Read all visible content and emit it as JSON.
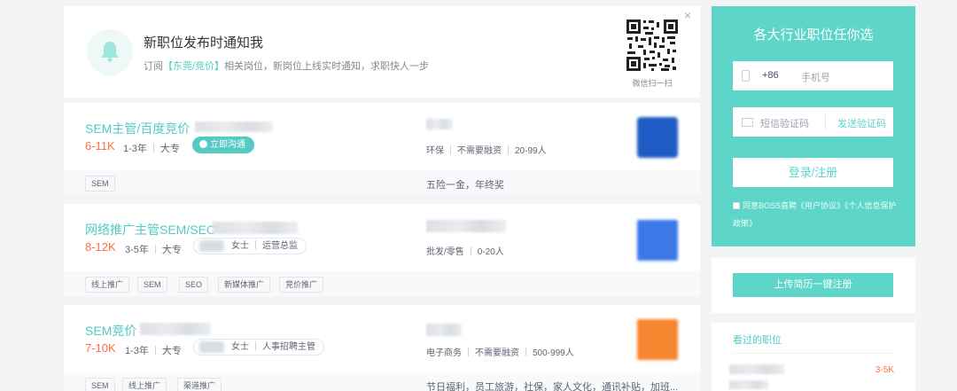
{
  "notify": {
    "title": "新职位发布时通知我",
    "sub_prefix": "订阅",
    "sub_highlight": "【东莞/竞价】",
    "sub_suffix": "相关岗位，新岗位上线实时通知，求职快人一步",
    "qr_label": "微信扫一扫",
    "close": "×"
  },
  "jobs": [
    {
      "title": "SEM主管/百度竞价",
      "salary": "6-11K",
      "experience": "1-3年",
      "education": "大专",
      "chat_label": "立即沟通",
      "company_industry": "环保",
      "company_funding": "不需要融资",
      "company_size": "20-99人",
      "tags": [
        "SEM"
      ],
      "welfare": "五险一金，年终奖",
      "logo_color": "#1f5bc4"
    },
    {
      "title": "网络推广主管SEM/SEO",
      "salary": "8-12K",
      "experience": "3-5年",
      "education": "大专",
      "hr_suffix": "女士",
      "hr_role": "运营总监",
      "company_industry": "批发/零售",
      "company_size": "0-20人",
      "tags": [
        "线上推广",
        "SEM",
        "SEO",
        "新媒体推广",
        "竞价推广"
      ],
      "welfare": "",
      "logo_color": "#3b79e8"
    },
    {
      "title": "SEM竞价",
      "salary": "7-10K",
      "experience": "1-3年",
      "education": "大专",
      "hr_suffix": "女士",
      "hr_role": "人事招聘主管",
      "company_industry": "电子商务",
      "company_funding": "不需要融资",
      "company_size": "500-999人",
      "tags": [
        "SEM",
        "线上推广",
        "渠道推广"
      ],
      "welfare": "节日福利，员工旅游，社保，家人文化，通讯补贴，加班...",
      "logo_color": "#f5852e"
    }
  ],
  "register": {
    "title": "各大行业职位任你选",
    "country_code": "+86",
    "phone_placeholder": "手机号",
    "sms_placeholder": "短信验证码",
    "send_code": "发送验证码",
    "login_button": "登录/注册",
    "agree_text": "同意BOSS直聘《用户协议》《个人信息保护政策》"
  },
  "upload_button": "上传简历一键注册",
  "viewed": {
    "title": "看过的职位",
    "salary": "3-5K"
  },
  "colors": {
    "accent": "#53cac3",
    "salary": "#fc703e",
    "register_bg": "#5dd5c8"
  }
}
